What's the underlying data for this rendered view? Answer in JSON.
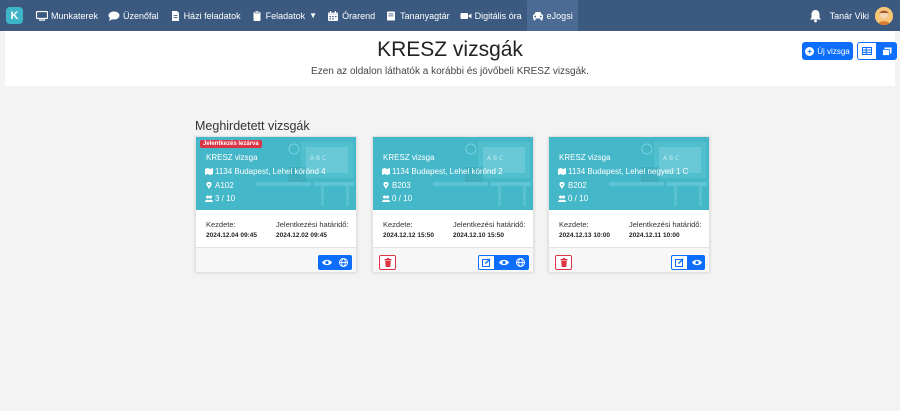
{
  "navbar": {
    "logo_letter": "K",
    "items": [
      {
        "label": "Munkaterek",
        "icon": "monitor-icon"
      },
      {
        "label": "Üzenőfal",
        "icon": "chat-bubble-icon"
      },
      {
        "label": "Házi feladatok",
        "icon": "document-icon"
      },
      {
        "label": "Feladatok",
        "icon": "tasks-icon",
        "dropdown": true
      },
      {
        "label": "Órarend",
        "icon": "calendar-icon"
      },
      {
        "label": "Tananyagtár",
        "icon": "book-icon"
      },
      {
        "label": "Digitális óra",
        "icon": "video-camera-icon"
      },
      {
        "label": "eJogsi",
        "icon": "car-icon",
        "active": true
      }
    ],
    "user_name": "Tanár Viki"
  },
  "header": {
    "title": "KRESZ vizsgák",
    "subtitle": "Ezen az oldalon láthatók a korábbi és jövőbeli KRESZ vizsgák.",
    "new_exam_label": "Új vizsga"
  },
  "section": {
    "title": "Meghirdetett vizsgák"
  },
  "labels": {
    "start": "Kezdete:",
    "deadline": "Jelentkezési határidő:"
  },
  "exams": [
    {
      "badge": "Jelentkezés lezárva",
      "title": "KRESZ vizsga",
      "address": "1134 Budapest, Lehel körönd 4",
      "room": "A102",
      "participants": "3 / 10",
      "start": "2024.12.04 09:45",
      "deadline": "2024.12.02 09:45",
      "actions": [
        "view",
        "globe"
      ]
    },
    {
      "title": "KRESZ vizsga",
      "address": "1134 Budapest, Lehel körönd 2",
      "room": "B203",
      "participants": "0 / 10",
      "start": "2024.12.12 15:50",
      "deadline": "2024.12.10 15:50",
      "actions": [
        "delete",
        "edit",
        "view",
        "globe"
      ]
    },
    {
      "title": "KRESZ vizsga",
      "address": "1134 Budapest, Lehel negyed 1 C",
      "room": "B202",
      "participants": "0 / 10",
      "start": "2024.12.13 10:00",
      "deadline": "2024.12.11 10:00",
      "actions": [
        "delete",
        "edit",
        "view"
      ]
    }
  ]
}
